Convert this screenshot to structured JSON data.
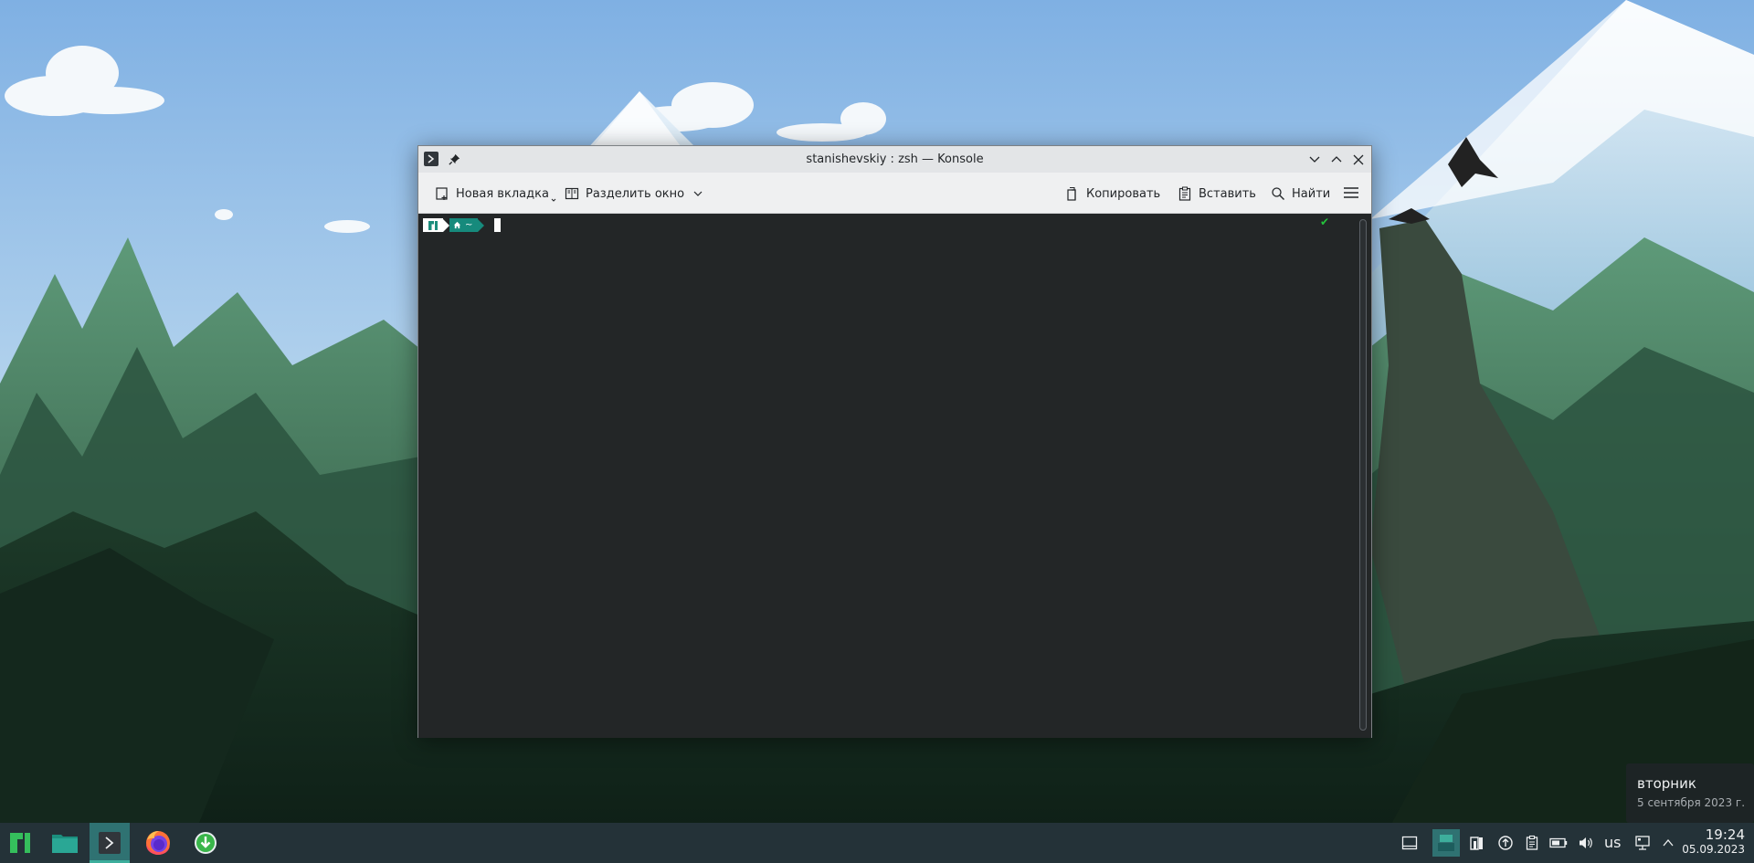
{
  "window": {
    "title": "stanishevskiy : zsh — Konsole"
  },
  "toolbar": {
    "new_tab_label": "Новая вкладка",
    "split_label": "Разделить окно",
    "copy_label": "Копировать",
    "paste_label": "Вставить",
    "find_label": "Найти"
  },
  "terminal": {
    "prompt_dir": "~",
    "status_symbol": "✔"
  },
  "date_popup": {
    "weekday": "вторник",
    "full_date": "5 сентября 2023 г."
  },
  "taskbar": {
    "launchers": [
      "manjaro-menu-icon",
      "file-manager-icon",
      "konsole-icon",
      "firefox-icon",
      "downloader-icon"
    ],
    "keyboard_layout": "us",
    "time": "19:24",
    "date": "05.09.2023"
  },
  "colors": {
    "accent": "#168a7c",
    "taskbar_bg": "#243238",
    "terminal_bg": "#232627"
  }
}
